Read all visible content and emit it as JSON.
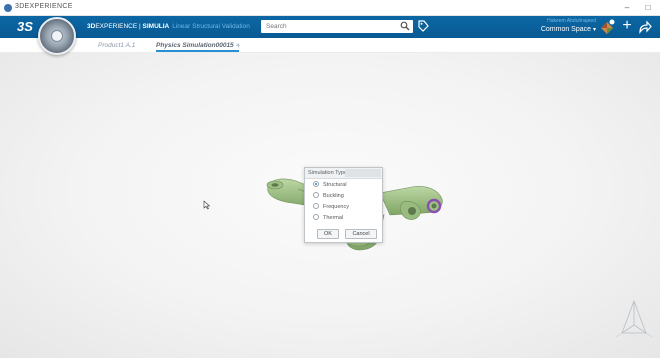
{
  "window": {
    "title": "3DEXPERIENCE",
    "minimize": "–",
    "maximize": "□"
  },
  "topbar": {
    "brand_3d": "3D",
    "brand_experience": "EXPERIENCE | ",
    "brand_app": "SIMULIA",
    "brand_role": "Linear Structural Validation",
    "search_placeholder": "Search",
    "user_name": "Hakeem Abdulmajeed",
    "collab_space": "Common Space",
    "chevron": "▾",
    "plus": "+"
  },
  "tabs": {
    "items": [
      {
        "label": "Product1 A.1",
        "active": false
      },
      {
        "label": "Physics Simulation00015",
        "active": true
      }
    ],
    "active_close": "×",
    "add": "+"
  },
  "dialog": {
    "title": "Simulation Type",
    "options": [
      {
        "label": "Structural",
        "checked": true
      },
      {
        "label": "Buckling",
        "checked": false
      },
      {
        "label": "Frequency",
        "checked": false
      },
      {
        "label": "Thermal",
        "checked": false
      }
    ],
    "ok_label": "OK",
    "cancel_label": "Cancel"
  },
  "colors": {
    "topbar": "#0c67a4",
    "tab_underline": "#2a8fd0",
    "part": "#a6c58c",
    "highlight_ring": "#8a4fb0"
  }
}
